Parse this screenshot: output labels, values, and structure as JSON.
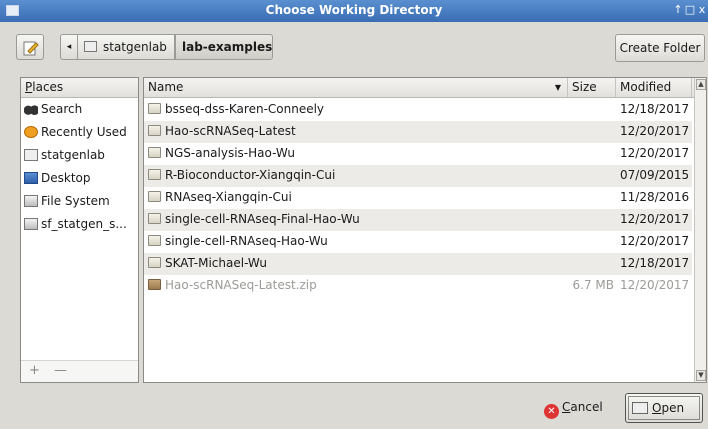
{
  "window": {
    "title": "Choose Working Directory",
    "controls": [
      "↑",
      "□",
      "x"
    ]
  },
  "pathbar": {
    "back_glyph": "◂",
    "crumbs": [
      "statgenlab",
      "lab-examples"
    ],
    "create_folder": "Create Folder"
  },
  "places": {
    "header": "Places",
    "items": [
      {
        "label": "Search",
        "icon": "binoculars-icon"
      },
      {
        "label": "Recently Used",
        "icon": "clock-icon"
      },
      {
        "label": "statgenlab",
        "icon": "home-folder-icon"
      },
      {
        "label": "Desktop",
        "icon": "desktop-icon"
      },
      {
        "label": "File System",
        "icon": "drive-icon"
      },
      {
        "label": "sf_statgen_s...",
        "icon": "drive-icon"
      }
    ],
    "footer": {
      "add": "+",
      "remove": "—"
    }
  },
  "files": {
    "columns": {
      "name": "Name",
      "size": "Size",
      "modified": "Modified",
      "sort_glyph": "▼"
    },
    "rows": [
      {
        "name": "bsseq-dss-Karen-Conneely",
        "size": "",
        "modified": "12/18/2017",
        "type": "folder"
      },
      {
        "name": "Hao-scRNASeq-Latest",
        "size": "",
        "modified": "12/20/2017",
        "type": "folder"
      },
      {
        "name": "NGS-analysis-Hao-Wu",
        "size": "",
        "modified": "12/20/2017",
        "type": "folder"
      },
      {
        "name": "R-Bioconductor-Xiangqin-Cui",
        "size": "",
        "modified": "07/09/2015",
        "type": "folder"
      },
      {
        "name": "RNAseq-Xiangqin-Cui",
        "size": "",
        "modified": "11/28/2016",
        "type": "folder"
      },
      {
        "name": "single-cell-RNAseq-Final-Hao-Wu",
        "size": "",
        "modified": "12/20/2017",
        "type": "folder"
      },
      {
        "name": "single-cell-RNAseq-Hao-Wu",
        "size": "",
        "modified": "12/20/2017",
        "type": "folder"
      },
      {
        "name": "SKAT-Michael-Wu",
        "size": "",
        "modified": "12/18/2017",
        "type": "folder"
      },
      {
        "name": "Hao-scRNASeq-Latest.zip",
        "size": "6.7 MB",
        "modified": "12/20/2017",
        "type": "zip"
      }
    ]
  },
  "buttons": {
    "cancel": {
      "mnemonic": "C",
      "rest": "ancel"
    },
    "open": {
      "mnemonic": "O",
      "rest": "pen"
    }
  }
}
